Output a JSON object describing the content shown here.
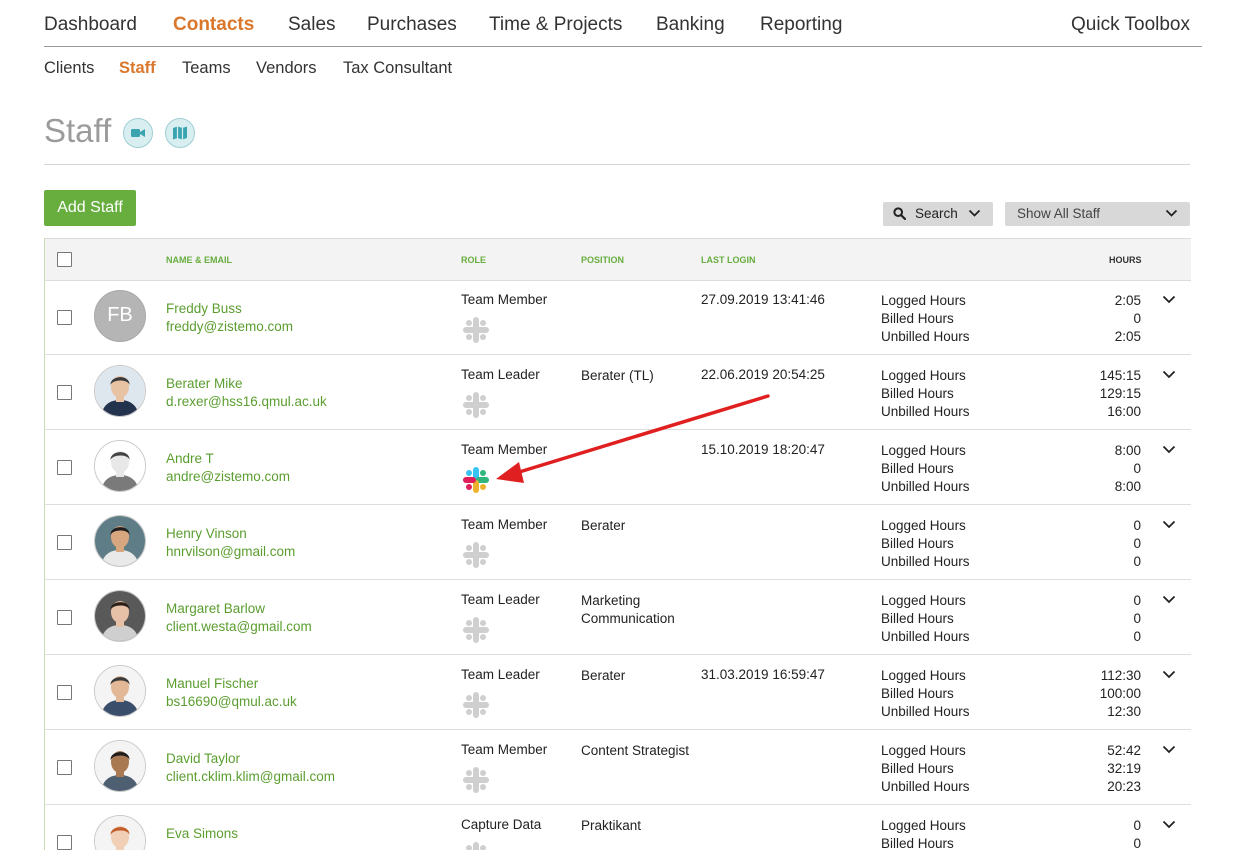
{
  "nav": {
    "items": [
      "Dashboard",
      "Contacts",
      "Sales",
      "Purchases",
      "Time & Projects",
      "Banking",
      "Reporting"
    ],
    "active": "Contacts",
    "quick_toolbox": "Quick Toolbox",
    "accent_color": "#d9782c"
  },
  "subnav": {
    "items": [
      "Clients",
      "Staff",
      "Teams",
      "Vendors",
      "Tax Consultant"
    ],
    "active": "Staff"
  },
  "page": {
    "title": "Staff",
    "icons": [
      "video-icon",
      "map-icon"
    ]
  },
  "toolbar": {
    "add_label": "Add Staff",
    "add_color": "#67ae3f",
    "search_label": "Search",
    "filter_value": "Show All Staff"
  },
  "table": {
    "headers": {
      "name": "NAME & EMAIL",
      "role": "ROLE",
      "position": "POSITION",
      "last_login": "LAST LOGIN",
      "hours": "HOURS"
    },
    "hour_labels": [
      "Logged Hours",
      "Billed Hours",
      "Unbilled Hours"
    ],
    "rows": [
      {
        "initials": "FB",
        "name": "Freddy Buss",
        "email": "freddy@zistemo.com",
        "role": "Team Member",
        "position": "",
        "last_login": "27.09.2019 13:41:46",
        "hours": [
          "2:05",
          "0",
          "2:05"
        ],
        "slack_connected": false
      },
      {
        "name": "Berater Mike",
        "email": "d.rexer@hss16.qmul.ac.uk",
        "role": "Team Leader",
        "position": "Berater (TL)",
        "last_login": "22.06.2019 20:54:25",
        "hours": [
          "145:15",
          "129:15",
          "16:00"
        ],
        "slack_connected": false
      },
      {
        "name": "Andre T",
        "email": "andre@zistemo.com",
        "role": "Team Member",
        "position": "",
        "last_login": "15.10.2019 18:20:47",
        "hours": [
          "8:00",
          "0",
          "8:00"
        ],
        "slack_connected": true
      },
      {
        "name": "Henry Vinson",
        "email": "hnrvilson@gmail.com",
        "role": "Team Member",
        "position": "Berater",
        "last_login": "",
        "hours": [
          "0",
          "0",
          "0"
        ],
        "slack_connected": false
      },
      {
        "name": "Margaret Barlow",
        "email": "client.westa@gmail.com",
        "role": "Team Leader",
        "position": "Marketing Communication",
        "last_login": "",
        "hours": [
          "0",
          "0",
          "0"
        ],
        "slack_connected": false
      },
      {
        "name": "Manuel Fischer",
        "email": "bs16690@qmul.ac.uk",
        "role": "Team Leader",
        "position": "Berater",
        "last_login": "31.03.2019 16:59:47",
        "hours": [
          "112:30",
          "100:00",
          "12:30"
        ],
        "slack_connected": false
      },
      {
        "name": "David Taylor",
        "email": "client.cklim.klim@gmail.com",
        "role": "Team Member",
        "position": "Content Strategist",
        "last_login": "",
        "hours": [
          "52:42",
          "32:19",
          "20:23"
        ],
        "slack_connected": false
      },
      {
        "name": "Eva Simons",
        "email": "",
        "role": "Capture Data",
        "position": "Praktikant",
        "last_login": "",
        "hours": [
          "0",
          "0",
          ""
        ],
        "slack_connected": false
      }
    ]
  },
  "annotation": {
    "type": "arrow",
    "color": "#e02020"
  }
}
